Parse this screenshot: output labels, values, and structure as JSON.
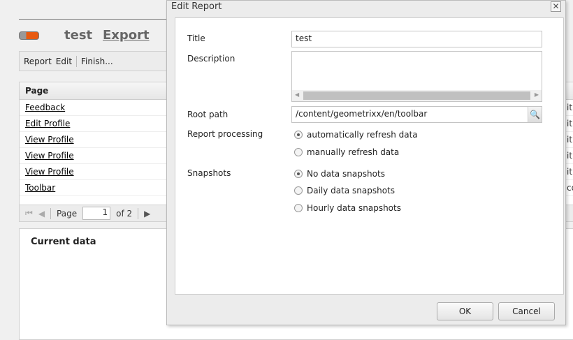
{
  "page": {
    "title": "test",
    "export": "Export"
  },
  "toolbar": {
    "report": "Report",
    "edit": "Edit",
    "finish": "Finish..."
  },
  "grid": {
    "header": "Page",
    "rows": [
      {
        "page": "Feedback",
        "right": "itl"
      },
      {
        "page": "Edit Profile",
        "right": "itl"
      },
      {
        "page": "View Profile",
        "right": "itl"
      },
      {
        "page": "View Profile",
        "right": "itl"
      },
      {
        "page": "View Profile",
        "right": "itl"
      },
      {
        "page": "Toolbar",
        "right": "co"
      }
    ]
  },
  "pager": {
    "label": "Page",
    "value": "1",
    "of": "of 2"
  },
  "lower": {
    "title": "Current data"
  },
  "dialog": {
    "title": "Edit Report",
    "labels": {
      "title": "Title",
      "description": "Description",
      "root": "Root path",
      "processing": "Report processing",
      "snapshots": "Snapshots"
    },
    "title_value": "test",
    "description_value": "",
    "root_value": "/content/geometrixx/en/toolbar",
    "processing_options": [
      {
        "label": "automatically refresh data",
        "checked": true
      },
      {
        "label": "manually refresh data",
        "checked": false
      }
    ],
    "snapshot_options": [
      {
        "label": "No data snapshots",
        "checked": true
      },
      {
        "label": "Daily data snapshots",
        "checked": false
      },
      {
        "label": "Hourly data snapshots",
        "checked": false
      }
    ],
    "ok": "OK",
    "cancel": "Cancel"
  }
}
